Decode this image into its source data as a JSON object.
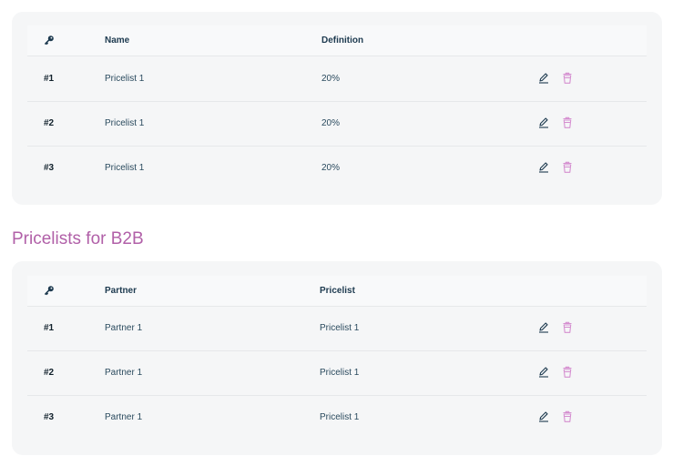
{
  "section1": {
    "columns": {
      "icon": "key-icon",
      "col1": "Name",
      "col2": "Definition"
    },
    "rows": [
      {
        "id": "#1",
        "col1": "Pricelist 1",
        "col2": "20%"
      },
      {
        "id": "#2",
        "col1": "Pricelist 1",
        "col2": "20%"
      },
      {
        "id": "#3",
        "col1": "Pricelist 1",
        "col2": "20%"
      }
    ]
  },
  "section2": {
    "title": "Pricelists for B2B",
    "columns": {
      "icon": "key-icon",
      "col1": "Partner",
      "col2": "Pricelist"
    },
    "rows": [
      {
        "id": "#1",
        "col1": "Partner 1",
        "col2": "Pricelist 1"
      },
      {
        "id": "#2",
        "col1": "Partner 1",
        "col2": "Pricelist 1"
      },
      {
        "id": "#3",
        "col1": "Partner 1",
        "col2": "Pricelist 1"
      }
    ]
  },
  "colors": {
    "title": "#b160a8",
    "edit_icon": "#1d3a4f",
    "delete_icon": "#d58fd0"
  }
}
